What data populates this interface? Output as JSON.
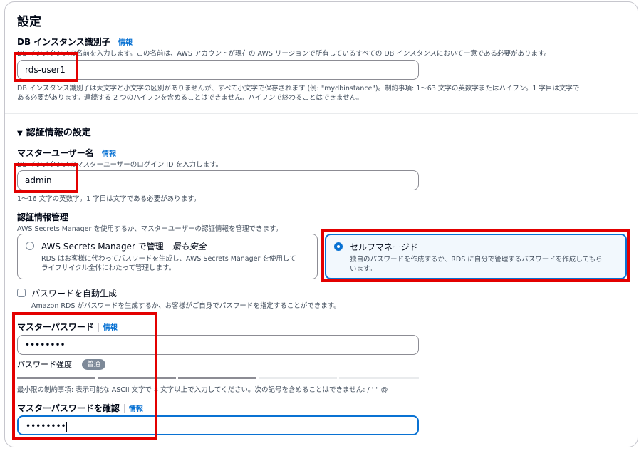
{
  "section_title": "設定",
  "db_identifier": {
    "label": "DB インスタンス識別子",
    "info": "情報",
    "description": "DB インスタンスの名前を入力します。この名前は、AWS アカウントが現在の AWS リージョンで所有しているすべての DB インスタンスにおいて一意である必要があります。",
    "value": "rds-user1",
    "constraint_line1": "DB インスタンス識別子は大文字と小文字の区別がありませんが、すべて小文字で保存されます (例: \"mydbinstance\")。制約事項: 1〜63 文字の英数字またはハイフン。1 字目は文字で",
    "constraint_line2": "ある必要があります。連続する 2 つのハイフンを含めることはできません。ハイフンで終わることはできません。"
  },
  "credentials": {
    "section_title": "認証情報の設定",
    "master_username": {
      "label": "マスターユーザー名",
      "info": "情報",
      "description": "DB インスタンスのマスターユーザーのログイン ID を入力します。",
      "value": "admin",
      "constraint": "1〜16 文字の英数字。1 字目は文字である必要があります。"
    },
    "management": {
      "label": "認証情報管理",
      "description": "AWS Secrets Manager を使用するか、マスターユーザーの認証情報を管理できます。",
      "option_secrets": {
        "title_prefix": "AWS Secrets Manager で管理 - ",
        "title_emphasis": "最も安全",
        "desc_line1": "RDS はお客様に代わってパスワードを生成し、AWS Secrets Manager を使用して",
        "desc_line2": "ライフサイクル全体にわたって管理します。",
        "selected": false
      },
      "option_self": {
        "title": "セルフマネージド",
        "desc_line1": "独自のパスワードを作成するか、RDS に自分で管理するパスワードを作成してもら",
        "desc_line2": "います。",
        "selected": true
      }
    },
    "auto_generate": {
      "label": "パスワードを自動生成",
      "description": "Amazon RDS がパスワードを生成するか、お客様がご自身でパスワードを指定することができます。",
      "checked": false
    },
    "master_password": {
      "label": "マスターパスワード",
      "info": "情報",
      "value": "••••••••",
      "strength_label": "パスワード強度",
      "strength_badge": "普通",
      "strength_fraction": 0.5,
      "constraint": "最小限の制約事項: 表示可能な ASCII 文字で 8 文字以上で入力してください。次の記号を含めることはできません: / ' \" @"
    },
    "confirm_password": {
      "label": "マスターパスワードを確認",
      "info": "情報",
      "value": "••••••••"
    }
  },
  "colors": {
    "highlight": "#e30000",
    "accent": "#0972d3",
    "selected_card_bg": "#f2f8fd"
  }
}
